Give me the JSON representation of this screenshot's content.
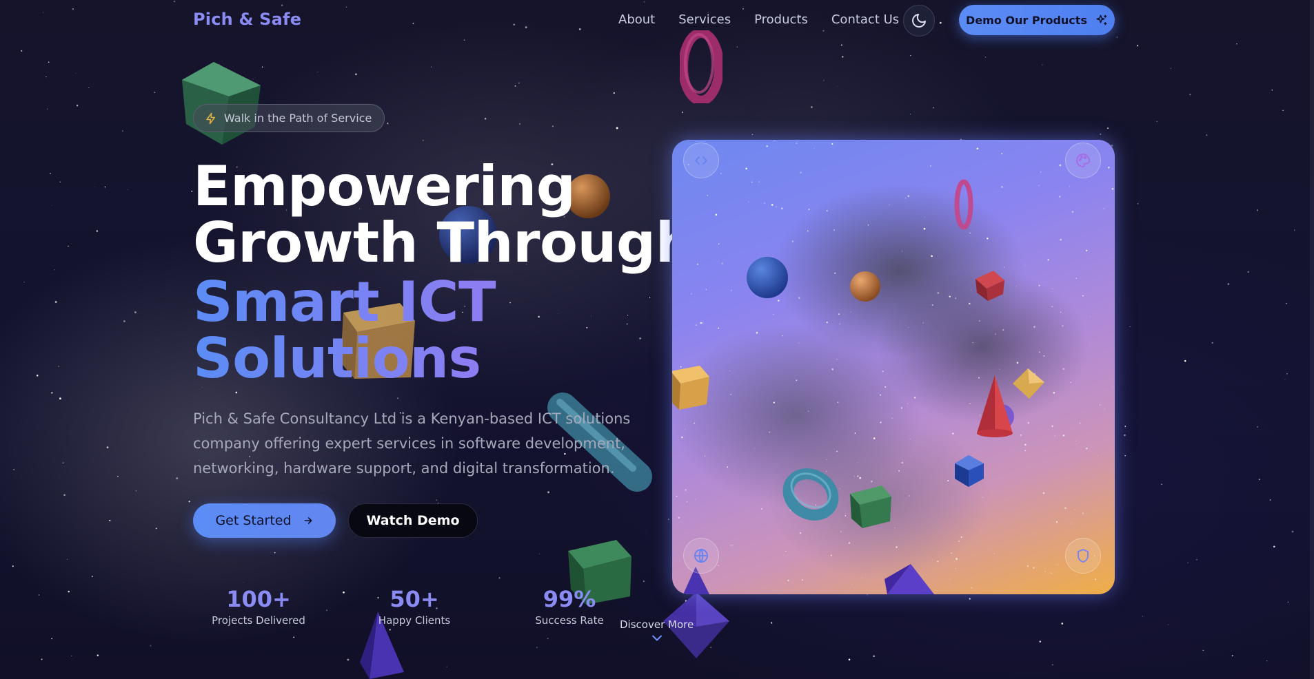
{
  "nav": {
    "logo": "Pich & Safe",
    "links": [
      "About",
      "Services",
      "Products",
      "Contact Us"
    ],
    "theme_toggle_icon": "moon-icon",
    "cta_label": "Demo Our Products",
    "cta_icon": "sparkles-icon"
  },
  "hero": {
    "badge_icon": "lightning-icon",
    "badge_text": "Walk in the Path of Service",
    "headline_line1": "Empowering",
    "headline_line2": "Growth Through",
    "headline_accent1": "Smart ICT",
    "headline_accent2": "Solutions",
    "description": "Pich & Safe Consultancy Ltd is a Kenyan-based ICT solutions company offering expert services in software development, networking, hardware support, and digital transformation.",
    "primary_button": "Get Started",
    "primary_button_icon": "arrow-right-icon",
    "secondary_button": "Watch Demo",
    "stats": [
      {
        "value": "100+",
        "label": "Projects Delivered"
      },
      {
        "value": "50+",
        "label": "Happy Clients"
      },
      {
        "value": "99%",
        "label": "Success Rate"
      }
    ],
    "discover_label": "Discover More",
    "discover_icon": "chevron-down-icon"
  },
  "card": {
    "icons": [
      "code-icon",
      "palette-icon",
      "globe-icon",
      "shield-icon"
    ]
  },
  "colors": {
    "background": "#121127",
    "accent_blue": "#5b8cf5",
    "accent_purple": "#8a8cf3",
    "card_gradient_start": "#6e88f0",
    "card_gradient_end": "#eeae46"
  }
}
